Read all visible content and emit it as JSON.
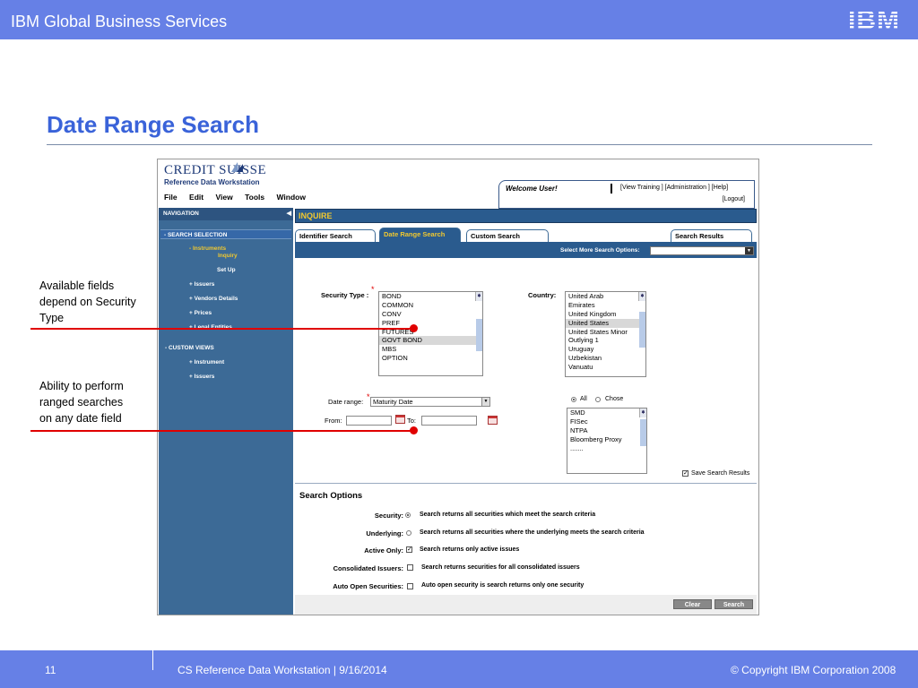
{
  "slide": {
    "header": "IBM Global Business Services",
    "logo": "IBM",
    "title": "Date Range Search",
    "callout1": [
      "Available fields",
      "depend on Security",
      "Type"
    ],
    "callout2": [
      "Ability to perform",
      "ranged searches",
      "on any date field"
    ],
    "page_number": "11",
    "footer_center": "CS Reference Data Workstation  |  9/16/2014",
    "copyright": "© Copyright IBM Corporation 2008",
    "colors": {
      "bar": "#6680e6",
      "title": "#3a63d9",
      "callout_line": "#e00000"
    }
  },
  "app": {
    "brand": "CREDIT SUISSE",
    "subtitle": "Reference Data Workstation",
    "menu": [
      "File",
      "Edit",
      "View",
      "Tools",
      "Window"
    ],
    "welcome": "Welcome User!",
    "links": "[View Training ] [Administration ] [Help]",
    "logout": "[Logout]",
    "nav": {
      "header": "NAVIGATION",
      "search_selection": "-  SEARCH SELECTION",
      "instruments": "-  Instruments",
      "inquiry": "Inquiry",
      "setup": "Set Up",
      "issuers": "+  Issuers",
      "vendors": "+  Vendors Details",
      "prices": "+  Prices",
      "legal": "+  Legal Entities",
      "custom_views": "-  CUSTOM VIEWS",
      "cv_instrument": "+ Instrument",
      "cv_issuers": "+ Issuers"
    },
    "inquire": "INQUIRE",
    "tabs": [
      "Identifier Search",
      "Date Range Search",
      "Custom Search",
      "Search Results"
    ],
    "select_more": "Select More Search Options:",
    "security_type_label": "Security Type :",
    "security_types": [
      "BOND",
      "COMMON",
      "CONV",
      "PREF",
      "FUTURES",
      "GOVT BOND",
      "MBS",
      "OPTION"
    ],
    "security_selected": "GOVT BOND",
    "country_label": "Country:",
    "countries": [
      "United Arab",
      "Emirates",
      "United Kingdom",
      "United States",
      "United States Minor",
      "Outlying 1",
      "Uruguay",
      "Uzbekistan",
      "Vanuatu"
    ],
    "country_selected": "United States",
    "date_range_label": "Date range:",
    "date_range_value": "Maturity Date",
    "from_label": "From:",
    "to_label": "To:",
    "all_label": "All",
    "chose_label": "Chose",
    "sources": [
      "SMD",
      "FISec",
      "NTPA",
      "Bloomberg Proxy",
      "......."
    ],
    "save_results": "Save Search Results",
    "search_options_title": "Search Options",
    "options": [
      {
        "label": "Security:",
        "desc": "Search returns all securities which  meet the search criteria"
      },
      {
        "label": "Underlying:",
        "desc": "Search returns all securities where the underlying meets the search criteria"
      },
      {
        "label": "Active Only:",
        "desc": "Search returns only active issues"
      },
      {
        "label": "Consolidated Issuers:",
        "desc": "Search returns securities for all consolidated issuers"
      },
      {
        "label": "Auto Open Securities:",
        "desc": "Auto open security is search returns only one security"
      }
    ],
    "clear_button": "Clear",
    "search_button": "Search"
  }
}
